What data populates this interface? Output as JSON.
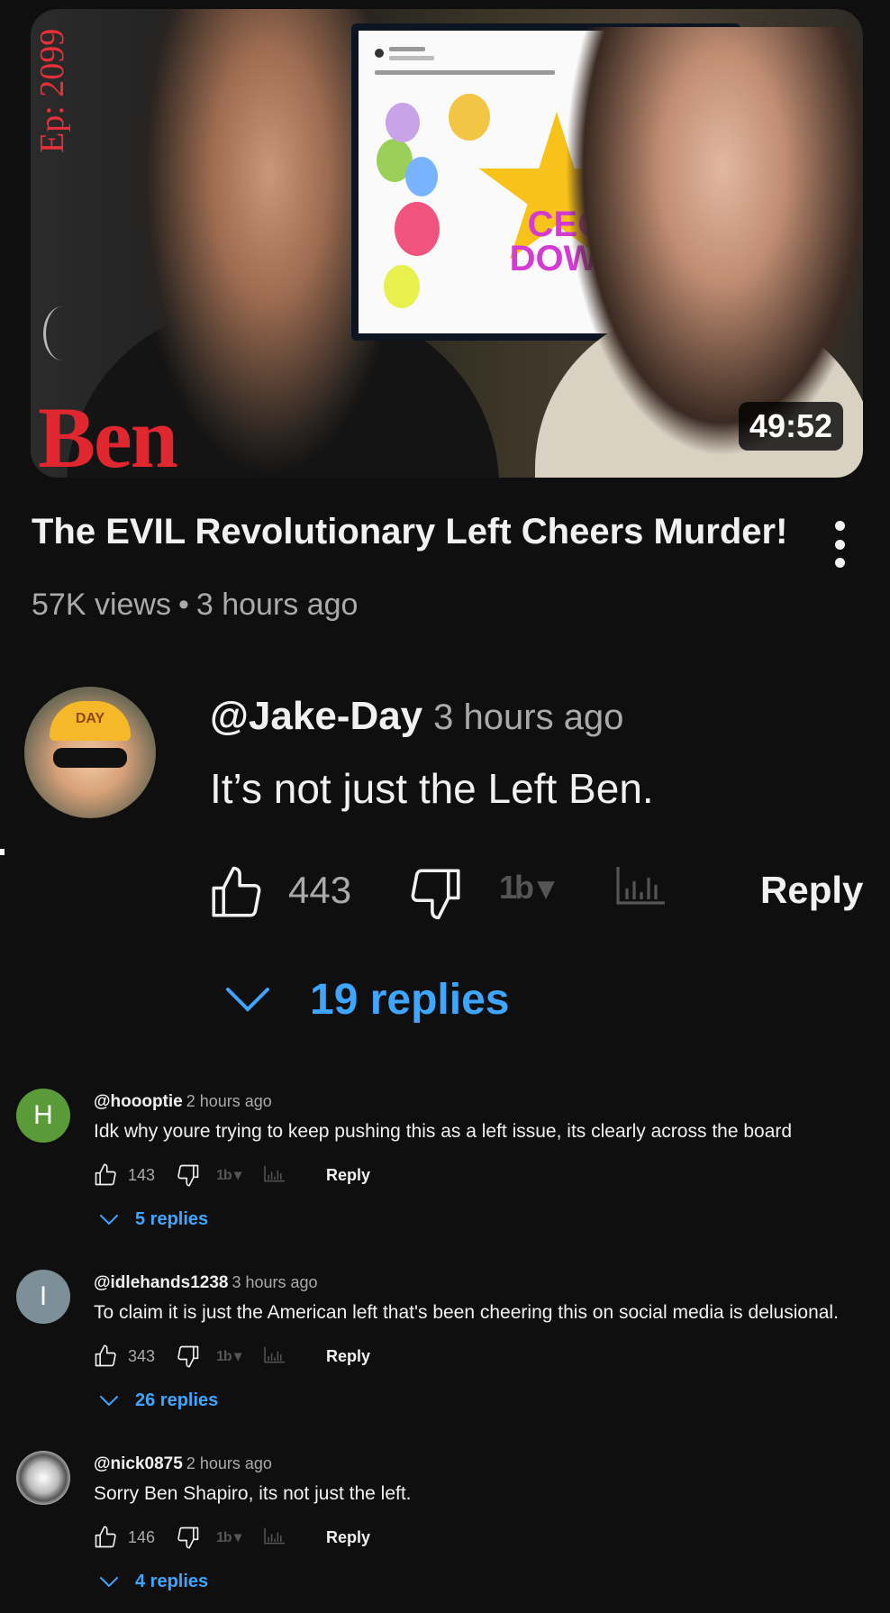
{
  "thumbnail": {
    "episode": "Ep: 2099",
    "brand": "Ben",
    "screen_text": "CEO DOWN",
    "duration": "49:52"
  },
  "video": {
    "title": "The EVIL Revolutionary Left Cheers Murder!",
    "views": "57K views",
    "separator": "•",
    "age": "3 hours ago"
  },
  "featured_comment": {
    "author": "@Jake-Day",
    "time": "3 hours ago",
    "text": "It’s not just the Left Ben.",
    "likes": "443",
    "extension_label": "1b ▾",
    "reply_label": "Reply",
    "replies_label": "19 replies",
    "avatar_cap_text": "DAY"
  },
  "comments": [
    {
      "avatar_letter": "H",
      "avatar_color": "#5a9a39",
      "author": "@hoooptie",
      "time": "2 hours ago",
      "text": "Idk why youre trying to keep pushing this as a left issue, its clearly across the board",
      "likes": "143",
      "extension_label": "1b ▾",
      "reply_label": "Reply",
      "replies_label": "5 replies"
    },
    {
      "avatar_letter": "I",
      "avatar_color": "#7d8f99",
      "author": "@idlehands1238",
      "time": "3 hours ago",
      "text": "To claim it is just the American left that's been cheering this on social media is delusional.",
      "likes": "343",
      "extension_label": "1b ▾",
      "reply_label": "Reply",
      "replies_label": "26 replies"
    },
    {
      "avatar_letter": "",
      "avatar_color": "#d8d8d8",
      "author": "@nick0875",
      "time": "2 hours ago",
      "text": "Sorry Ben Shapiro, its not just the left.",
      "likes": "146",
      "extension_label": "1b ▾",
      "reply_label": "Reply",
      "replies_label": "4 replies"
    }
  ],
  "colors": {
    "background": "#0f0f0f",
    "link_blue": "#3ea6ff",
    "secondary_text": "#aaaaaa"
  }
}
